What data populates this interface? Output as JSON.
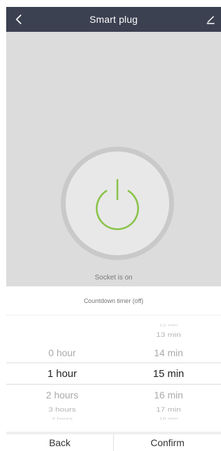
{
  "header": {
    "title": "Smart plug",
    "back_icon": "chevron-left-icon",
    "edit_icon": "pencil-icon"
  },
  "device": {
    "status": "Socket is on",
    "power_icon": "power-icon",
    "power_color": "#8bc34a"
  },
  "timer": {
    "label": "Countdown timer (off)"
  },
  "picker": {
    "hours": [
      "0 hour",
      "1 hour",
      "2 hours",
      "3 hours",
      "4 hours"
    ],
    "minutes": [
      "12 min",
      "13 min",
      "14 min",
      "15 min",
      "16 min",
      "17 min",
      "18 min"
    ],
    "selected_hour": "1 hour",
    "selected_minute": "15 min"
  },
  "footer": {
    "back_label": "Back",
    "confirm_label": "Confirm"
  },
  "colors": {
    "header_bg": "#3c4151",
    "stage_bg": "#dcdcdc"
  }
}
